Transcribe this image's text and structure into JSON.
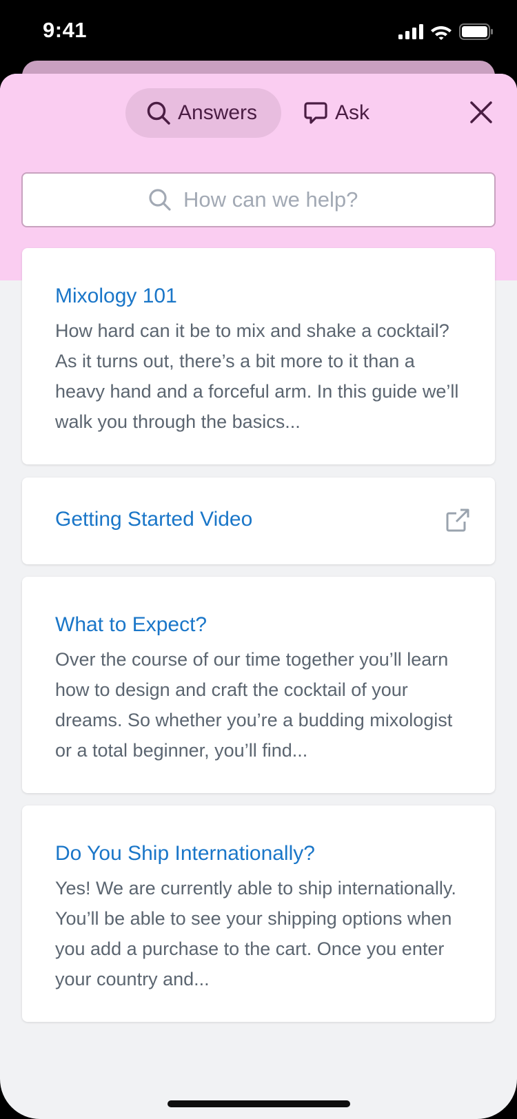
{
  "status_bar": {
    "time": "9:41",
    "icons": [
      "signal-icon",
      "wifi-icon",
      "battery-icon"
    ]
  },
  "tabs": [
    {
      "label": "Answers",
      "icon": "search-icon",
      "active": true
    },
    {
      "label": "Ask",
      "icon": "chat-bubble-icon",
      "active": false
    }
  ],
  "search": {
    "placeholder": "How can we help?",
    "value": ""
  },
  "articles": [
    {
      "title": "Mixology 101",
      "body": "How hard can it be to mix and shake a cocktail? As it turns out, there’s a bit more to it than a heavy hand and a forceful arm. In this guide we’ll walk you through the basics..."
    },
    {
      "title": "Getting Started Video",
      "icon": "external-link-icon"
    },
    {
      "title": "What to Expect?",
      "body": "Over the course of our time together you’ll learn how to design and craft the cocktail of your dreams. So whether you’re a budding mixologist or a total beginner, you’ll find..."
    },
    {
      "title": "Do You Ship Internationally?",
      "body": "Yes! We are currently able to ship internationally. You’ll be able to see your shipping options when you add a purchase to the cart. Once you enter your country and..."
    }
  ],
  "colors": {
    "header_bg": "#facdf1",
    "active_tab_bg": "#e8bddf",
    "accent_text": "#4a1d43",
    "link": "#1a76c8",
    "body_text": "#5b6570",
    "page_bg": "#f1f2f4"
  }
}
